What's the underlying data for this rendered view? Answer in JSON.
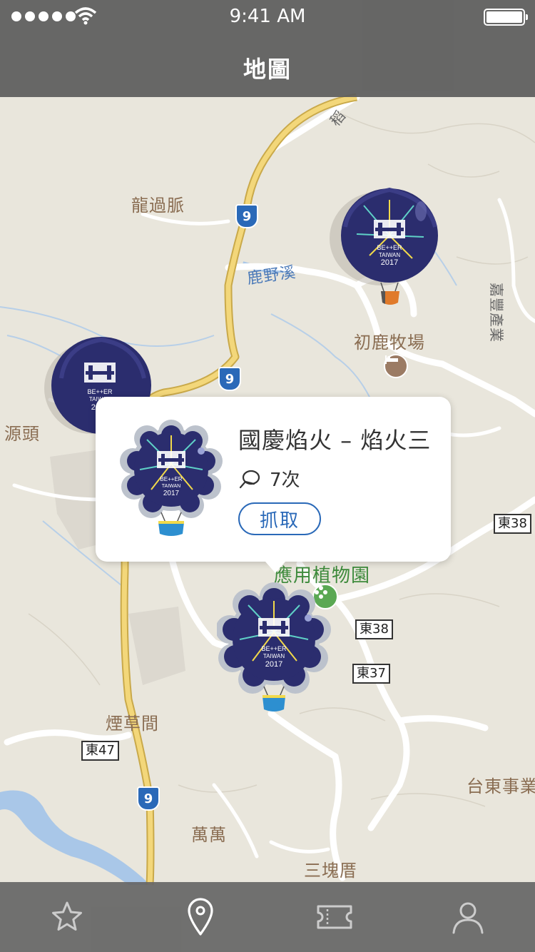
{
  "status_bar": {
    "time": "9:41 AM"
  },
  "nav": {
    "title": "地圖"
  },
  "map": {
    "places": {
      "longguomai": "龍過脈",
      "luyexi": "鹿野溪",
      "chuluranch": "初鹿牧場",
      "yuantou": "源頭",
      "botanical": "應用植物園",
      "yancaojian": "煙草間",
      "wanwan": "萬萬",
      "sankuicuo": "三塊厝",
      "taidongshiye": "台東事業",
      "jiafeng": "嘉豐產業",
      "dao": "稻"
    },
    "route_shields": [
      "9",
      "9",
      "9"
    ],
    "road_tags": [
      "東38",
      "東38",
      "東37",
      "東47"
    ]
  },
  "popup": {
    "title": "國慶焰火 – 焰火三",
    "count": "7次",
    "catch_label": "抓取",
    "balloon_text": {
      "line1": "BE++ER",
      "line2": "TAIWAN",
      "year": "2017"
    }
  },
  "tabs": [
    {
      "name": "favorites",
      "icon": "star-icon"
    },
    {
      "name": "map",
      "icon": "location-pin-icon"
    },
    {
      "name": "tickets",
      "icon": "ticket-icon"
    },
    {
      "name": "profile",
      "icon": "person-icon"
    }
  ],
  "colors": {
    "accent": "#2a69b8",
    "balloon_fill": "#2b2d6e",
    "map_bg": "#e9e6dc",
    "highway": "#f3d77a"
  }
}
